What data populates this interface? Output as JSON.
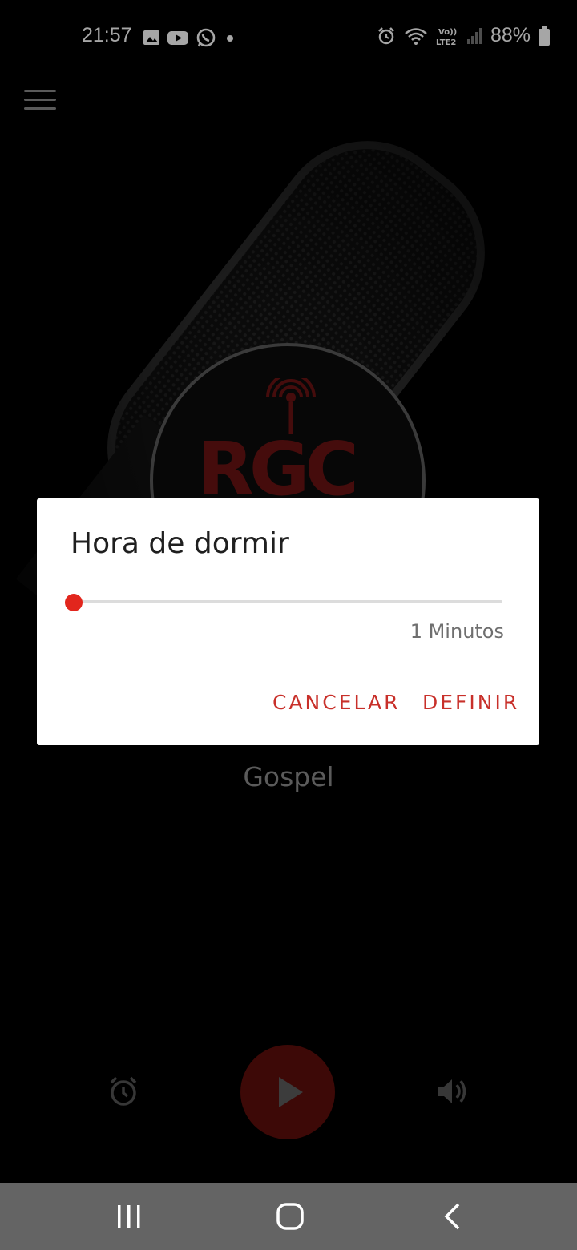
{
  "status_bar": {
    "time": "21:57",
    "battery": "88%",
    "icons_left": [
      "gallery-icon",
      "youtube-icon",
      "whatsapp-icon",
      "notification-dot-icon"
    ],
    "icons_right": [
      "alarm-icon",
      "wifi-icon",
      "volte-lte2-icon",
      "signal-icon",
      "battery-icon"
    ],
    "network_label": "Vo)) LTE2"
  },
  "app": {
    "logo_text": "RGC",
    "genre": "Gospel",
    "accent_color": "#e2261d",
    "player_controls": [
      "alarm-icon",
      "play-icon",
      "volume-icon"
    ]
  },
  "dialog": {
    "title": "Hora de dormir",
    "slider_value_label": "1 Minutos",
    "slider_fraction": 0.0,
    "cancel_label": "CANCELAR",
    "define_label": "DEFINIR"
  },
  "nav_bar": {
    "buttons": [
      "recent-apps-icon",
      "home-icon",
      "back-icon"
    ]
  }
}
